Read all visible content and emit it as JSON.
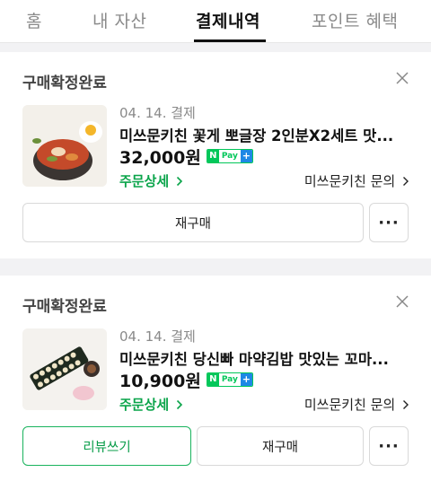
{
  "tabs": [
    {
      "label": "홈"
    },
    {
      "label": "내 자산"
    },
    {
      "label": "결제내역"
    },
    {
      "label": "포인트 혜택"
    }
  ],
  "orders": [
    {
      "status": "구매확정완료",
      "date": "04. 14. 결제",
      "product": "미쓰문키친 꽃게 뽀글장 2인분X2세트 맛...",
      "price": "32,000원",
      "badge": {
        "n": "N",
        "pay": "Pay",
        "plus": "+"
      },
      "detail_link": "주문상세",
      "inquiry_link": "미쓰문키친 문의",
      "rebuy_label": "재구매",
      "more_label": "···"
    },
    {
      "status": "구매확정완료",
      "date": "04. 14. 결제",
      "product": "미쓰문키친 당신빠 마약김밥 맛있는 꼬마...",
      "price": "10,900원",
      "badge": {
        "n": "N",
        "pay": "Pay",
        "plus": "+"
      },
      "detail_link": "주문상세",
      "inquiry_link": "미쓰문키친 문의",
      "review_label": "리뷰쓰기",
      "rebuy_label": "재구매",
      "more_label": "···"
    }
  ],
  "colors": {
    "accent": "#03c75a",
    "link_green": "#0aa44a",
    "plus_blue": "#1e88e5"
  }
}
